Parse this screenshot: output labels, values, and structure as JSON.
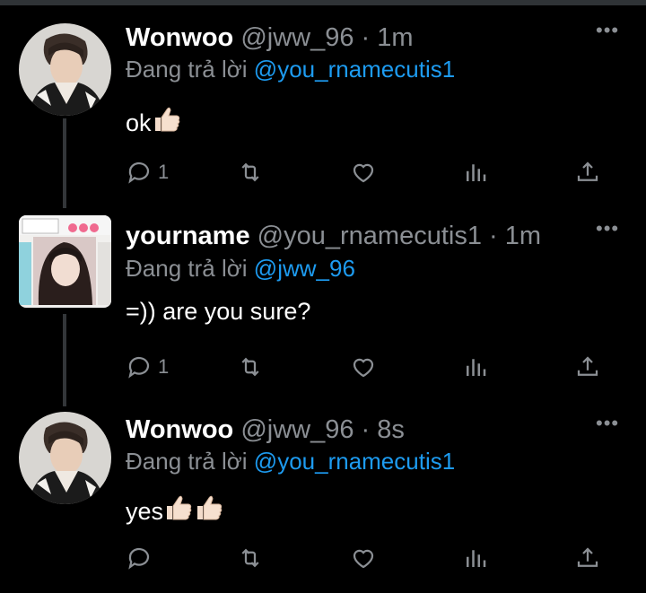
{
  "tweets": [
    {
      "name": "Wonwoo",
      "handle_time": "@jww_96 · 1m",
      "replying_prefix": "Đang trả lời",
      "replying_to": "@you_rnamecutis1",
      "text": "ok",
      "emoji": [
        "thumbs-up"
      ],
      "reply_count": "1",
      "avatar": "avatar-wonwoo"
    },
    {
      "name": "yourname",
      "handle_time": "@you_rnamecutis1 · 1m",
      "replying_prefix": "Đang trả lời",
      "replying_to": "@jww_96",
      "text": "=)) are you sure?",
      "emoji": [],
      "reply_count": "1",
      "avatar": "avatar-yourname"
    },
    {
      "name": "Wonwoo",
      "handle_time": "@jww_96 · 8s",
      "replying_prefix": "Đang trả lời",
      "replying_to": "@you_rnamecutis1",
      "text": "yes",
      "emoji": [
        "thumbs-up",
        "thumbs-up"
      ],
      "reply_count": "",
      "avatar": "avatar-wonwoo"
    }
  ],
  "more_label": "•••",
  "icons": [
    "reply-icon",
    "retweet-icon",
    "like-icon",
    "analytics-icon",
    "share-icon"
  ],
  "colors": {
    "background": "#000000",
    "link": "#1d9bf0",
    "muted": "#8b8f94",
    "text": "#ffffff"
  }
}
